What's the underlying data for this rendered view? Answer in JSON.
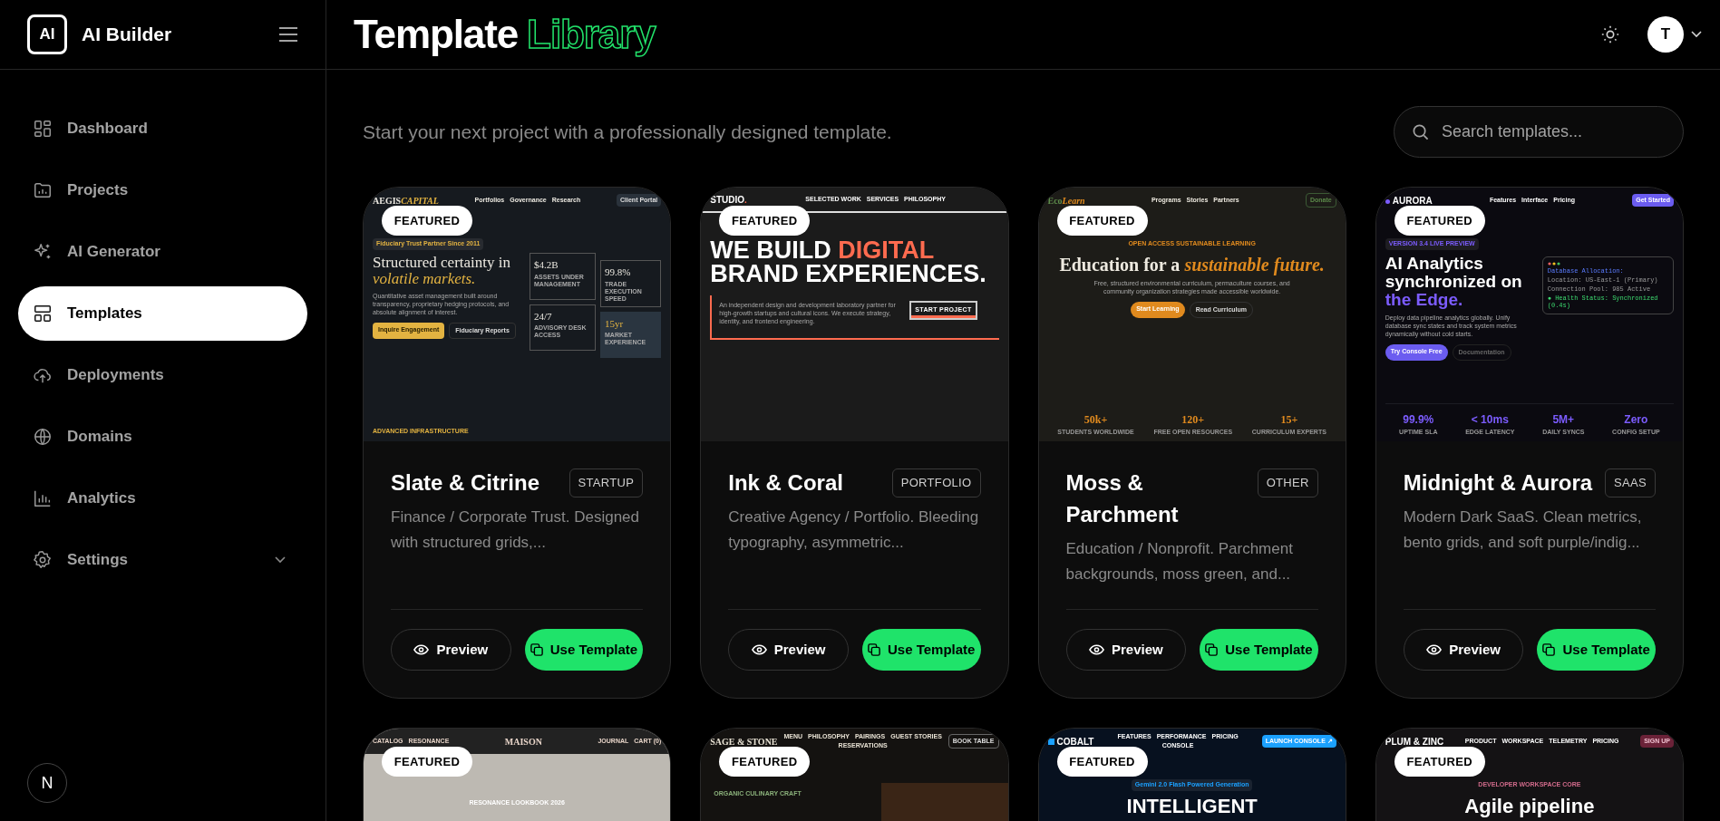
{
  "sidebar": {
    "logo_mark": "AI",
    "app_name": "AI Builder",
    "items": [
      {
        "label": "Dashboard",
        "selected": false,
        "has_submenu": false
      },
      {
        "label": "Projects",
        "selected": false,
        "has_submenu": false
      },
      {
        "label": "AI Generator",
        "selected": false,
        "has_submenu": false
      },
      {
        "label": "Templates",
        "selected": true,
        "has_submenu": false
      },
      {
        "label": "Deployments",
        "selected": false,
        "has_submenu": false
      },
      {
        "label": "Domains",
        "selected": false,
        "has_submenu": false
      },
      {
        "label": "Analytics",
        "selected": false,
        "has_submenu": false
      },
      {
        "label": "Settings",
        "selected": false,
        "has_submenu": true
      }
    ],
    "footer_badge": "N"
  },
  "header": {
    "title": [
      {
        "text": "Template",
        "accent": false
      },
      {
        "text": "Library",
        "accent": true
      }
    ],
    "avatar": "T"
  },
  "subtitle": "Start your next project with a professionally designed template.",
  "search": {
    "placeholder": "Search templates..."
  },
  "templates": [
    {
      "badge": "FEATURED",
      "name": "Slate & Citrine",
      "tag": "STARTUP",
      "description": "Finance / Corporate Trust. Designed with structured grids,...",
      "preview_button": "Preview",
      "use_button": "Use Template",
      "preview": {
        "kind": "finance",
        "logo": [
          {
            "text": "AEGIS",
            "accent": false
          },
          {
            "text": "CAPITAL",
            "accent": true
          }
        ],
        "nav": [
          "Portfolios",
          "Governance",
          "Research"
        ],
        "nav_button": "Client Portal",
        "eyebrow": "Fiduciary Trust Partner Since 2011",
        "headline": [
          {
            "text": "Structured certainty in ",
            "accent": false
          },
          {
            "text": "volatile markets.",
            "accent": true
          }
        ],
        "paragraph": "Quantitative asset management built around transparency, proprietary hedging protocols, and absolute alignment of interest.",
        "buttons": [
          {
            "label": "Inquire Engagement",
            "primary": true
          },
          {
            "label": "Fiduciary Reports",
            "primary": false
          }
        ],
        "side_stats": [
          {
            "value": "$4.2B",
            "label": "ASSETS UNDER MANAGEMENT",
            "highlight": false
          },
          {
            "value": "24/7",
            "label": "ADVISORY DESK ACCESS",
            "highlight": false
          },
          {
            "value": "99.8%",
            "label": "TRADE EXECUTION SPEED",
            "highlight": false
          },
          {
            "value": "15yr",
            "label": "MARKET EXPERIENCE",
            "highlight": true
          }
        ],
        "footer": "ADVANCED INFRASTRUCTURE"
      }
    },
    {
      "badge": "FEATURED",
      "name": "Ink & Coral",
      "tag": "PORTFOLIO",
      "description": "Creative Agency / Portfolio. Bleeding typography, asymmetric...",
      "preview_button": "Preview",
      "use_button": "Use Template",
      "preview": {
        "kind": "studio",
        "logo": [
          {
            "text": "STUDIO",
            "accent": false
          },
          {
            "text": ".",
            "accent": true
          }
        ],
        "nav": [
          "SELECTED WORK",
          "SERVICES",
          "PHILOSOPHY"
        ],
        "headline": [
          {
            "text": "WE BUILD ",
            "accent": false
          },
          {
            "text": "DIGITAL",
            "accent": true
          },
          {
            "text": " BRAND EXPERIENCES.",
            "accent": false
          }
        ],
        "paragraph": "An independent design and development laboratory partner for high-growth startups and cultural icons. We execute strategy, identity, and frontend engineering.",
        "buttons": [
          {
            "label": "START PROJECT",
            "primary": true
          }
        ]
      }
    },
    {
      "badge": "FEATURED",
      "name": "Moss & Parchment",
      "tag": "OTHER",
      "description": "Education / Nonprofit. Parchment backgrounds, moss green, and...",
      "preview_button": "Preview",
      "use_button": "Use Template",
      "preview": {
        "kind": "edu",
        "logo": [
          {
            "text": "Eco",
            "accent": false
          },
          {
            "text": "Learn",
            "accent": true
          }
        ],
        "nav": [
          "Programs",
          "Stories",
          "Partners"
        ],
        "nav_button": "Donate",
        "eyebrow": "OPEN ACCESS SUSTAINABLE LEARNING",
        "headline": [
          {
            "text": "Education for a ",
            "accent": false
          },
          {
            "text": "sustainable future.",
            "accent": true
          }
        ],
        "paragraph": "Free, structured environmental curriculum, permaculture courses, and community organization strategies made accessible worldwide.",
        "buttons": [
          {
            "label": "Start Learning",
            "primary": true
          },
          {
            "label": "Read Curriculum",
            "primary": false
          }
        ],
        "stats": [
          {
            "value": "50k+",
            "label": "STUDENTS WORLDWIDE"
          },
          {
            "value": "120+",
            "label": "FREE OPEN RESOURCES"
          },
          {
            "value": "15+",
            "label": "CURRICULUM EXPERTS"
          }
        ]
      }
    },
    {
      "badge": "FEATURED",
      "name": "Midnight & Aurora",
      "tag": "SAAS",
      "description": "Modern Dark SaaS. Clean metrics, bento grids, and soft purple/indig...",
      "preview_button": "Preview",
      "use_button": "Use Template",
      "preview": {
        "kind": "saas",
        "logo": [
          {
            "text": "AURORA",
            "accent": false
          }
        ],
        "nav": [
          "Features",
          "Interface",
          "Pricing"
        ],
        "nav_button": "Get Started",
        "eyebrow": "VERSION 3.4 LIVE PREVIEW",
        "headline": [
          {
            "text": "AI Analytics synchronized on ",
            "accent": false
          },
          {
            "text": "the Edge.",
            "accent": true
          }
        ],
        "paragraph": "Deploy data pipeline analytics globally. Unify database sync states and track system metrics dynamically without cold starts.",
        "buttons": [
          {
            "label": "Try Console Free",
            "primary": true
          },
          {
            "label": "Documentation",
            "primary": false
          }
        ],
        "terminal": [
          {
            "kind": "heading",
            "text": "Database Allocation:"
          },
          {
            "kind": "line",
            "text": "Location: US-East-1 (Primary)"
          },
          {
            "kind": "line",
            "text": "Connection Pool: 985 Active"
          },
          {
            "kind": "status",
            "text": "● Health Status: Synchronized (0.4s)"
          }
        ],
        "stats": [
          {
            "value": "99.9%",
            "label": "UPTIME SLA"
          },
          {
            "value": "< 10ms",
            "label": "EDGE LATENCY"
          },
          {
            "value": "5M+",
            "label": "DAILY SYNCS"
          },
          {
            "value": "Zero",
            "label": "CONFIG SETUP"
          }
        ]
      }
    },
    {
      "badge": "FEATURED",
      "preview": {
        "kind": "boutique",
        "logo": [
          {
            "text": "MAISON",
            "accent": false
          }
        ],
        "nav": [
          "CATALOG",
          "RESONANCE",
          "JOURNAL",
          "CART (0)"
        ],
        "eyebrow": "RESONANCE LOOKBOOK 2026"
      }
    },
    {
      "badge": "FEATURED",
      "preview": {
        "kind": "restaurant",
        "logo": [
          {
            "text": "SAGE & STONE",
            "accent": false
          }
        ],
        "nav": [
          "MENU",
          "PHILOSOPHY",
          "PAIRINGS",
          "GUEST STORIES",
          "RESERVATIONS"
        ],
        "nav_button": "BOOK TABLE",
        "eyebrow": "ORGANIC CULINARY CRAFT"
      }
    },
    {
      "badge": "FEATURED",
      "preview": {
        "kind": "cobalt",
        "logo": [
          {
            "text": "COBALT",
            "accent": false
          }
        ],
        "nav": [
          "FEATURES",
          "PERFORMANCE",
          "PRICING",
          "CONSOLE"
        ],
        "nav_button": "LAUNCH CONSOLE ↗",
        "eyebrow": "Gemini 2.0 Flash Powered Generation",
        "headline": [
          {
            "text": "INTELLIGENT",
            "accent": false
          }
        ]
      }
    },
    {
      "badge": "FEATURED",
      "preview": {
        "kind": "plum",
        "logo": [
          {
            "text": "PLUM & ZINC",
            "accent": false
          }
        ],
        "nav": [
          "PRODUCT",
          "WORKSPACE",
          "TELEMETRY",
          "PRICING"
        ],
        "nav_button": "SIGN UP",
        "eyebrow": "DEVELOPER WORKSPACE CORE",
        "headline": [
          {
            "text": "Agile pipeline",
            "accent": false
          }
        ]
      }
    }
  ]
}
